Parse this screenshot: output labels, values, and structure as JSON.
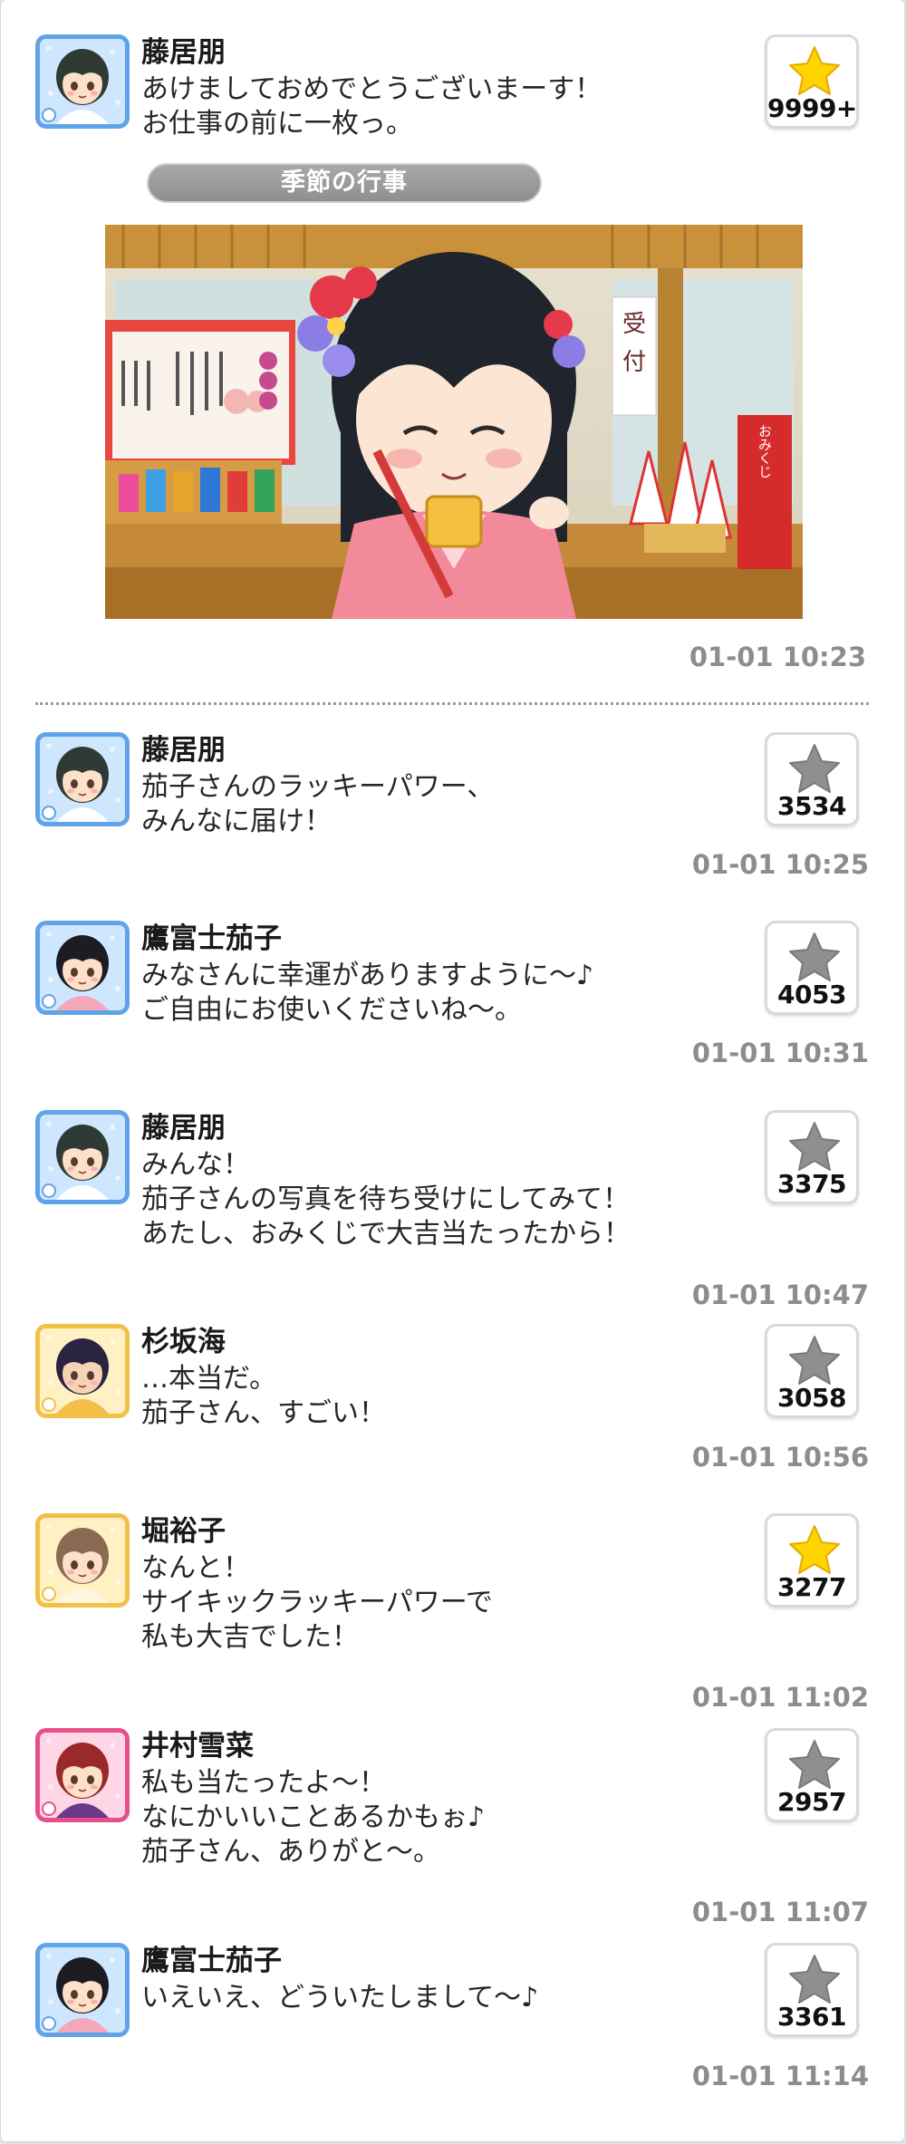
{
  "featured": {
    "name": "藤居朋",
    "message": "あけましておめでとうございまーす！\nお仕事の前に一枚っ。",
    "likes": "9999+",
    "liked": true,
    "tag": "季節の行事",
    "photo_sign": "受付",
    "photo_box": "おみくじ",
    "timestamp": "01-01 10:23",
    "avatar": {
      "frame": "#5fa3e8",
      "hair": "#2f3a34",
      "skin": "#fde0c8",
      "shirt": "#ffffff",
      "bg": "#cfe6ff"
    }
  },
  "comments": [
    {
      "name": "藤居朋",
      "message": "茄子さんのラッキーパワー、\nみんなに届け！",
      "likes": "3534",
      "liked": false,
      "timestamp": "01-01 10:25",
      "avatar": {
        "frame": "#5fa3e8",
        "hair": "#2f3a34",
        "skin": "#fde0c8",
        "shirt": "#ffffff",
        "bg": "#cfe6ff"
      }
    },
    {
      "name": "鷹富士茄子",
      "message": "みなさんに幸運がありますように〜♪\nご自由にお使いくださいね〜。",
      "likes": "4053",
      "liked": false,
      "timestamp": "01-01 10:31",
      "avatar": {
        "frame": "#5fa3e8",
        "hair": "#1c1c22",
        "skin": "#fde0c8",
        "shirt": "#f4a7b9",
        "bg": "#cfe6ff"
      }
    },
    {
      "name": "藤居朋",
      "message": "みんな！\n茄子さんの写真を待ち受けにしてみて！\nあたし、おみくじで大吉当たったから！",
      "likes": "3375",
      "liked": false,
      "timestamp": "01-01 10:47",
      "avatar": {
        "frame": "#5fa3e8",
        "hair": "#2f3a34",
        "skin": "#fde0c8",
        "shirt": "#ffffff",
        "bg": "#cfe6ff"
      }
    },
    {
      "name": "杉坂海",
      "message": "…本当だ。\n茄子さん、すごい！",
      "likes": "3058",
      "liked": false,
      "timestamp": "01-01 10:56",
      "avatar": {
        "frame": "#f2c048",
        "hair": "#2a2440",
        "skin": "#f7d3b6",
        "shirt": "#f2c048",
        "bg": "#fff1c4"
      }
    },
    {
      "name": "堀裕子",
      "message": "なんと！\nサイキックラッキーパワーで\n私も大吉でした！",
      "likes": "3277",
      "liked": true,
      "timestamp": "01-01 11:02",
      "avatar": {
        "frame": "#f2c048",
        "hair": "#8a6a52",
        "skin": "#fde0c8",
        "shirt": "#fff6e0",
        "bg": "#fff1c4"
      }
    },
    {
      "name": "井村雪菜",
      "message": "私も当たったよ〜！\nなにかいいことあるかもぉ♪\n茄子さん、ありがと〜。",
      "likes": "2957",
      "liked": false,
      "timestamp": "01-01 11:07",
      "avatar": {
        "frame": "#e8508a",
        "hair": "#9a2a2a",
        "skin": "#fde0c8",
        "shirt": "#6a3a8a",
        "bg": "#ffd6e6"
      }
    },
    {
      "name": "鷹富士茄子",
      "message": "いえいえ、どういたしまして〜♪",
      "likes": "3361",
      "liked": false,
      "timestamp": "01-01 11:14",
      "avatar": {
        "frame": "#5fa3e8",
        "hair": "#1c1c22",
        "skin": "#fde0c8",
        "shirt": "#f4a7b9",
        "bg": "#cfe6ff"
      }
    }
  ],
  "colors": {
    "star_gold": "#ffd400",
    "star_gray": "#8f8f8f",
    "timestamp": "#8d8d8d"
  },
  "icons": {
    "like": "star-icon"
  }
}
